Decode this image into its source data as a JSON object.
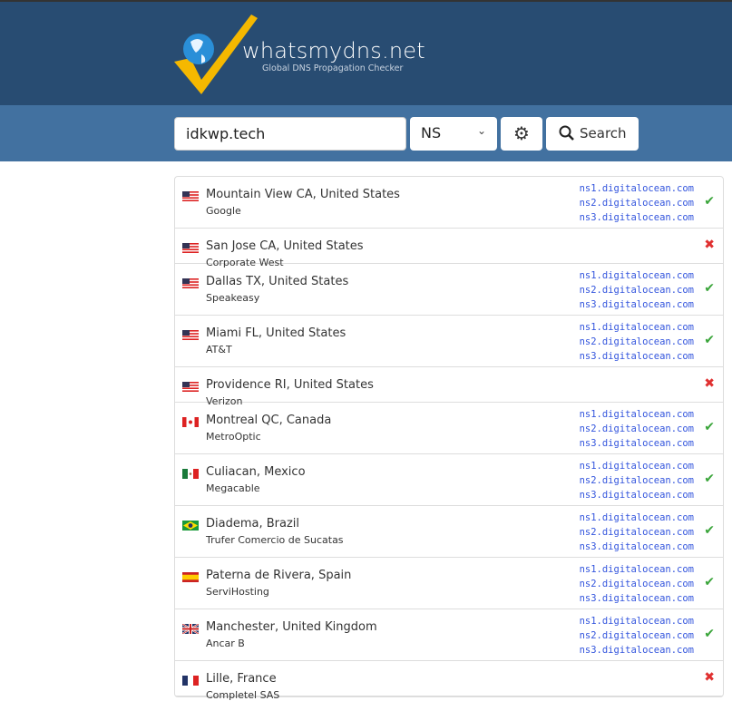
{
  "header": {
    "brand": "whatsmydns.net",
    "tagline": "Global DNS Propagation Checker"
  },
  "search": {
    "query": "idkwp.tech",
    "record_type": "NS",
    "search_label": "Search"
  },
  "colors": {
    "header": "#284c72",
    "search_bar": "#4271a0",
    "success": "#3aa53a",
    "fail": "#e03030",
    "record": "#3355dd"
  },
  "results": [
    {
      "location": "Mountain View CA, United States",
      "provider": "Google",
      "flag": "us",
      "status": "ok",
      "records": [
        "ns1.digitalocean.com",
        "ns2.digitalocean.com",
        "ns3.digitalocean.com"
      ]
    },
    {
      "location": "San Jose CA, United States",
      "provider": "Corporate West",
      "flag": "us",
      "status": "fail",
      "records": []
    },
    {
      "location": "Dallas TX, United States",
      "provider": "Speakeasy",
      "flag": "us",
      "status": "ok",
      "records": [
        "ns1.digitalocean.com",
        "ns2.digitalocean.com",
        "ns3.digitalocean.com"
      ]
    },
    {
      "location": "Miami FL, United States",
      "provider": "AT&T",
      "flag": "us",
      "status": "ok",
      "records": [
        "ns1.digitalocean.com",
        "ns2.digitalocean.com",
        "ns3.digitalocean.com"
      ]
    },
    {
      "location": "Providence RI, United States",
      "provider": "Verizon",
      "flag": "us",
      "status": "fail",
      "records": []
    },
    {
      "location": "Montreal QC, Canada",
      "provider": "MetroOptic",
      "flag": "ca",
      "status": "ok",
      "records": [
        "ns1.digitalocean.com",
        "ns2.digitalocean.com",
        "ns3.digitalocean.com"
      ]
    },
    {
      "location": "Culiacan, Mexico",
      "provider": "Megacable",
      "flag": "mx",
      "status": "ok",
      "records": [
        "ns1.digitalocean.com",
        "ns2.digitalocean.com",
        "ns3.digitalocean.com"
      ]
    },
    {
      "location": "Diadema, Brazil",
      "provider": "Trufer Comercio de Sucatas",
      "flag": "br",
      "status": "ok",
      "records": [
        "ns1.digitalocean.com",
        "ns2.digitalocean.com",
        "ns3.digitalocean.com"
      ]
    },
    {
      "location": "Paterna de Rivera, Spain",
      "provider": "ServiHosting",
      "flag": "es",
      "status": "ok",
      "records": [
        "ns1.digitalocean.com",
        "ns2.digitalocean.com",
        "ns3.digitalocean.com"
      ]
    },
    {
      "location": "Manchester, United Kingdom",
      "provider": "Ancar B",
      "flag": "gb",
      "status": "ok",
      "records": [
        "ns1.digitalocean.com",
        "ns2.digitalocean.com",
        "ns3.digitalocean.com"
      ]
    },
    {
      "location": "Lille, France",
      "provider": "Completel SAS",
      "flag": "fr",
      "status": "fail",
      "records": []
    }
  ]
}
